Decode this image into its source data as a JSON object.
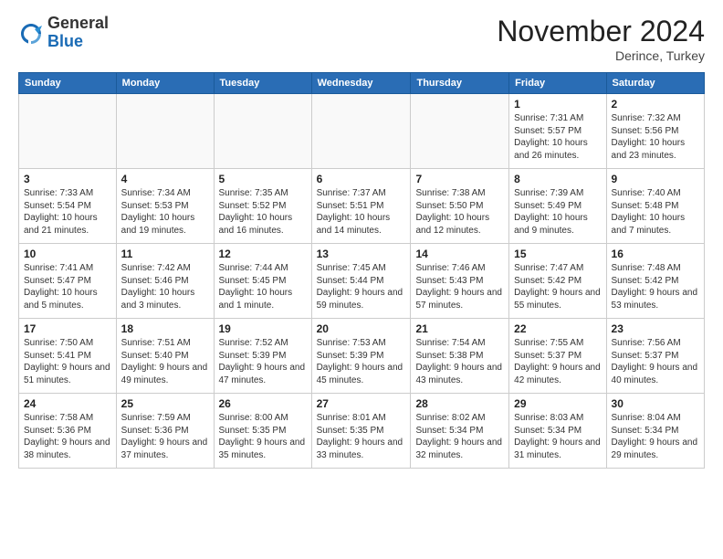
{
  "logo": {
    "general": "General",
    "blue": "Blue"
  },
  "title": "November 2024",
  "location": "Derince, Turkey",
  "days_of_week": [
    "Sunday",
    "Monday",
    "Tuesday",
    "Wednesday",
    "Thursday",
    "Friday",
    "Saturday"
  ],
  "weeks": [
    [
      {
        "day": "",
        "info": ""
      },
      {
        "day": "",
        "info": ""
      },
      {
        "day": "",
        "info": ""
      },
      {
        "day": "",
        "info": ""
      },
      {
        "day": "",
        "info": ""
      },
      {
        "day": "1",
        "info": "Sunrise: 7:31 AM\nSunset: 5:57 PM\nDaylight: 10 hours and 26 minutes."
      },
      {
        "day": "2",
        "info": "Sunrise: 7:32 AM\nSunset: 5:56 PM\nDaylight: 10 hours and 23 minutes."
      }
    ],
    [
      {
        "day": "3",
        "info": "Sunrise: 7:33 AM\nSunset: 5:54 PM\nDaylight: 10 hours and 21 minutes."
      },
      {
        "day": "4",
        "info": "Sunrise: 7:34 AM\nSunset: 5:53 PM\nDaylight: 10 hours and 19 minutes."
      },
      {
        "day": "5",
        "info": "Sunrise: 7:35 AM\nSunset: 5:52 PM\nDaylight: 10 hours and 16 minutes."
      },
      {
        "day": "6",
        "info": "Sunrise: 7:37 AM\nSunset: 5:51 PM\nDaylight: 10 hours and 14 minutes."
      },
      {
        "day": "7",
        "info": "Sunrise: 7:38 AM\nSunset: 5:50 PM\nDaylight: 10 hours and 12 minutes."
      },
      {
        "day": "8",
        "info": "Sunrise: 7:39 AM\nSunset: 5:49 PM\nDaylight: 10 hours and 9 minutes."
      },
      {
        "day": "9",
        "info": "Sunrise: 7:40 AM\nSunset: 5:48 PM\nDaylight: 10 hours and 7 minutes."
      }
    ],
    [
      {
        "day": "10",
        "info": "Sunrise: 7:41 AM\nSunset: 5:47 PM\nDaylight: 10 hours and 5 minutes."
      },
      {
        "day": "11",
        "info": "Sunrise: 7:42 AM\nSunset: 5:46 PM\nDaylight: 10 hours and 3 minutes."
      },
      {
        "day": "12",
        "info": "Sunrise: 7:44 AM\nSunset: 5:45 PM\nDaylight: 10 hours and 1 minute."
      },
      {
        "day": "13",
        "info": "Sunrise: 7:45 AM\nSunset: 5:44 PM\nDaylight: 9 hours and 59 minutes."
      },
      {
        "day": "14",
        "info": "Sunrise: 7:46 AM\nSunset: 5:43 PM\nDaylight: 9 hours and 57 minutes."
      },
      {
        "day": "15",
        "info": "Sunrise: 7:47 AM\nSunset: 5:42 PM\nDaylight: 9 hours and 55 minutes."
      },
      {
        "day": "16",
        "info": "Sunrise: 7:48 AM\nSunset: 5:42 PM\nDaylight: 9 hours and 53 minutes."
      }
    ],
    [
      {
        "day": "17",
        "info": "Sunrise: 7:50 AM\nSunset: 5:41 PM\nDaylight: 9 hours and 51 minutes."
      },
      {
        "day": "18",
        "info": "Sunrise: 7:51 AM\nSunset: 5:40 PM\nDaylight: 9 hours and 49 minutes."
      },
      {
        "day": "19",
        "info": "Sunrise: 7:52 AM\nSunset: 5:39 PM\nDaylight: 9 hours and 47 minutes."
      },
      {
        "day": "20",
        "info": "Sunrise: 7:53 AM\nSunset: 5:39 PM\nDaylight: 9 hours and 45 minutes."
      },
      {
        "day": "21",
        "info": "Sunrise: 7:54 AM\nSunset: 5:38 PM\nDaylight: 9 hours and 43 minutes."
      },
      {
        "day": "22",
        "info": "Sunrise: 7:55 AM\nSunset: 5:37 PM\nDaylight: 9 hours and 42 minutes."
      },
      {
        "day": "23",
        "info": "Sunrise: 7:56 AM\nSunset: 5:37 PM\nDaylight: 9 hours and 40 minutes."
      }
    ],
    [
      {
        "day": "24",
        "info": "Sunrise: 7:58 AM\nSunset: 5:36 PM\nDaylight: 9 hours and 38 minutes."
      },
      {
        "day": "25",
        "info": "Sunrise: 7:59 AM\nSunset: 5:36 PM\nDaylight: 9 hours and 37 minutes."
      },
      {
        "day": "26",
        "info": "Sunrise: 8:00 AM\nSunset: 5:35 PM\nDaylight: 9 hours and 35 minutes."
      },
      {
        "day": "27",
        "info": "Sunrise: 8:01 AM\nSunset: 5:35 PM\nDaylight: 9 hours and 33 minutes."
      },
      {
        "day": "28",
        "info": "Sunrise: 8:02 AM\nSunset: 5:34 PM\nDaylight: 9 hours and 32 minutes."
      },
      {
        "day": "29",
        "info": "Sunrise: 8:03 AM\nSunset: 5:34 PM\nDaylight: 9 hours and 31 minutes."
      },
      {
        "day": "30",
        "info": "Sunrise: 8:04 AM\nSunset: 5:34 PM\nDaylight: 9 hours and 29 minutes."
      }
    ]
  ]
}
